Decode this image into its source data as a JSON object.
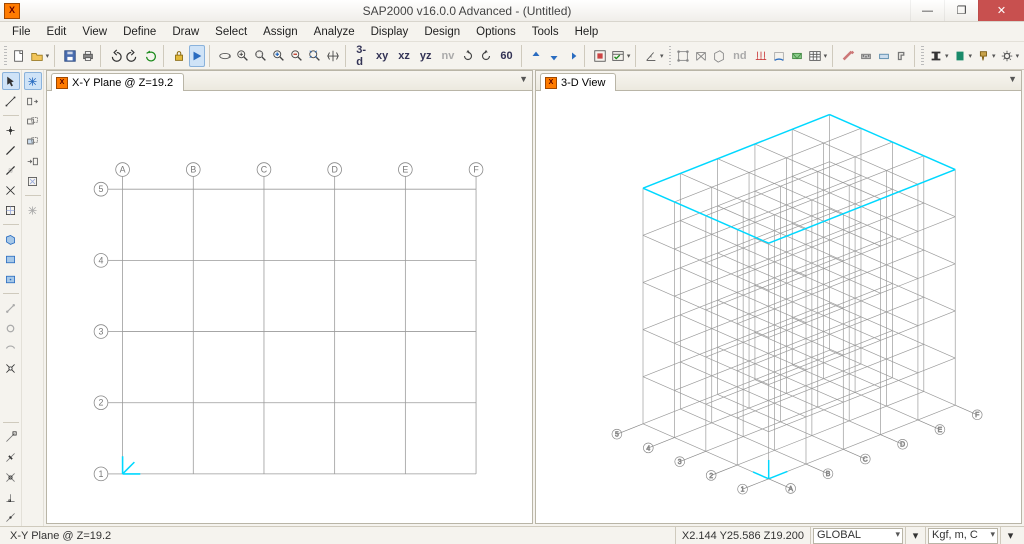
{
  "app": {
    "icon_letter": "X",
    "title": "SAP2000 v16.0.0 Advanced  - (Untitled)"
  },
  "menu": [
    "File",
    "Edit",
    "View",
    "Define",
    "Draw",
    "Select",
    "Assign",
    "Analyze",
    "Display",
    "Design",
    "Options",
    "Tools",
    "Help"
  ],
  "toolbar_text": {
    "threeD": "3-d",
    "xy": "xy",
    "xz": "xz",
    "yz": "yz",
    "nv": "nv",
    "sixty": "60",
    "nd": "nd"
  },
  "views": {
    "left": {
      "title": "X-Y Plane @ Z=19.2",
      "icon_letter": "X"
    },
    "right": {
      "title": "3-D View",
      "icon_letter": "X"
    }
  },
  "plan": {
    "col_labels": [
      "A",
      "B",
      "C",
      "D",
      "E",
      "F"
    ],
    "row_labels": [
      "5",
      "4",
      "3",
      "2",
      "1"
    ]
  },
  "status": {
    "left": "X-Y Plane @ Z=19.2",
    "coords": "X2.144  Y25.586  Z19.200",
    "coord_sys": "GLOBAL",
    "units": "Kgf, m, C"
  },
  "icon_names": {
    "new": "new",
    "open": "open",
    "save": "save",
    "print": "print",
    "undo": "undo",
    "redo": "redo",
    "refresh": "refresh",
    "lock": "lock",
    "run": "run",
    "rotate": "rotate",
    "zoom_area": "zoom-area",
    "zoom_out_area": "zoom-out-area",
    "zoom_in": "zoom-in",
    "zoom_out": "zoom-out",
    "zoom_ext": "zoom-extents",
    "pan": "pan",
    "up_arrow": "up",
    "down_arrow": "down",
    "right_arrow": "right",
    "shrink": "shrink",
    "options": "options",
    "angle": "angle",
    "ibeam": "i-section",
    "rect": "section",
    "paint": "paint",
    "chk": "check"
  }
}
